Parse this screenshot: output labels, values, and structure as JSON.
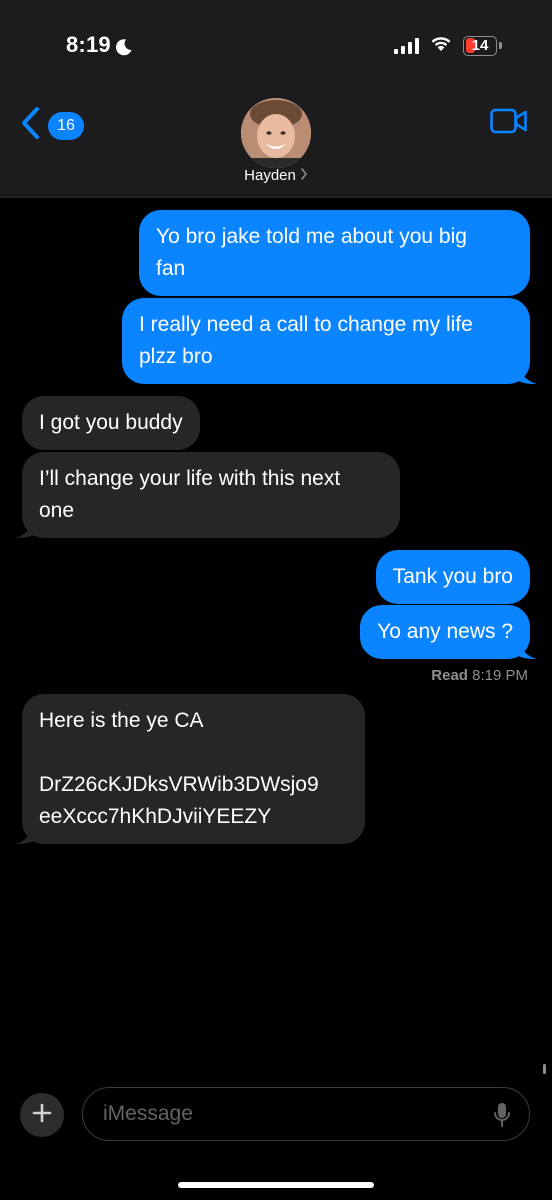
{
  "status_bar": {
    "time": "8:19",
    "battery": "14"
  },
  "header": {
    "back_count": "16",
    "contact_name": "Hayden",
    "accent": "#0a84ff"
  },
  "messages": [
    {
      "from": "me",
      "text": "Yo bro jake told me about you big\nfan"
    },
    {
      "from": "me",
      "text": "I really need a call to change my life\nplzz bro"
    },
    {
      "from": "them",
      "text": "I got you buddy"
    },
    {
      "from": "them",
      "text": "I’ll change your life with this next\none"
    },
    {
      "from": "me",
      "text": "Tank you bro"
    },
    {
      "from": "me",
      "text": "Yo any news ?"
    },
    {
      "from": "them",
      "text": "Here is the ye CA\n\nDrZ26cKJDksVRWib3DWsjo9\neeXccc7hKhDJviiYEEZY"
    }
  ],
  "read_receipt": {
    "label": "Read",
    "time": "8:19 PM"
  },
  "composer": {
    "placeholder": "iMessage"
  },
  "colors": {
    "sent_bubble": "#0a84ff",
    "received_bubble": "#262628",
    "background": "#000000"
  }
}
